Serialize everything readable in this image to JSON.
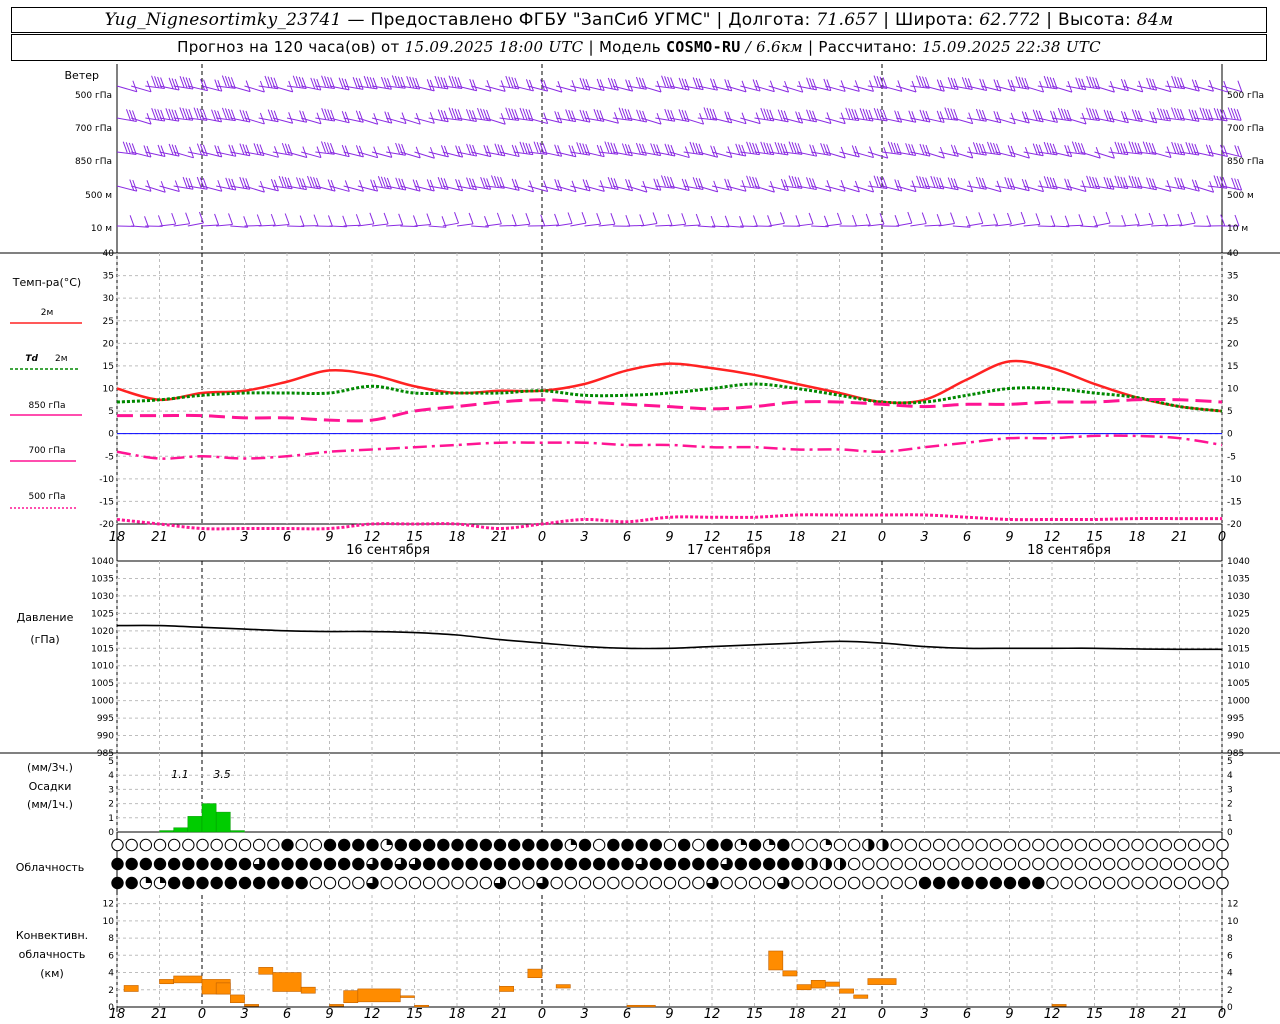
{
  "header": {
    "station": "Yug_Nignesortimky_23741",
    "provider": "— Предоставлено ФГБУ \"ЗапСиб УГМС\"",
    "lon_label": "Долгота:",
    "lon": "71.657",
    "lat_label": "Широта:",
    "lat": "62.772",
    "alt_label": "Высота:",
    "alt": "84м",
    "forecast_label": "Прогноз на 120 часа(ов) от",
    "forecast_start": "15.09.2025 18:00 UTC",
    "model_label": "Модель",
    "model": "COSMO-RU",
    "model_res": "/ 6.6км",
    "calc_label": "Рассчитано:",
    "calc_time": "15.09.2025 22:38 UTC"
  },
  "colors": {
    "t2m": "#ff2222",
    "td": "#008800",
    "t850": "#ff1493",
    "t700": "#ff1493",
    "t500": "#ff1493",
    "wind": "#8a2be2",
    "precip": "#00cc00",
    "conv": "#ff8c00",
    "pressure": "#000000",
    "zero": "#0000ff"
  },
  "wind_panel": {
    "title": "Ветер",
    "levels": [
      "500 гПа",
      "700 гПа",
      "850 гПа",
      "500 м",
      "10 м"
    ]
  },
  "temp_panel": {
    "title": "Темп-ра(°C)",
    "legend": [
      {
        "label": "2м",
        "style": "solid-red"
      },
      {
        "label": "Td",
        "label2": "2м",
        "style": "dotted-green"
      },
      {
        "label": "850 гПа",
        "style": "dashed-magenta"
      },
      {
        "label": "700 гПа",
        "style": "dashdot-magenta"
      },
      {
        "label": "500 гПа",
        "style": "dotted-magenta"
      }
    ]
  },
  "pressure_panel": {
    "title": "Давление",
    "unit": "(гПа)"
  },
  "precip_panel": {
    "unit_top": "(мм/3ч.)",
    "title": "Осадки",
    "unit_bottom": "(мм/1ч.)",
    "annotations": [
      "1.1",
      "3.5"
    ]
  },
  "cloud_panel": {
    "title": "Облачность"
  },
  "conv_panel": {
    "title_line1": "Конвективн.",
    "title_line2": "облачность",
    "unit": "(км)"
  },
  "time_ticks": [
    "18",
    "21",
    "0",
    "3",
    "6",
    "9",
    "12",
    "15",
    "18",
    "21",
    "0",
    "3",
    "6",
    "9",
    "12",
    "15",
    "18",
    "21",
    "0",
    "3",
    "6",
    "9",
    "12",
    "15",
    "18",
    "21",
    "0"
  ],
  "date_labels": [
    "16 сентября",
    "17 сентября",
    "18 сентября"
  ],
  "chart_data": [
    {
      "type": "line",
      "title": "Температура",
      "ylabel": "Темп-ра(°C)",
      "ylim": [
        -20,
        40
      ],
      "yticks": [
        40,
        35,
        30,
        25,
        20,
        15,
        10,
        5,
        0,
        -5,
        -10,
        -15,
        -20
      ],
      "x": [
        0,
        3,
        6,
        9,
        12,
        15,
        18,
        21,
        24,
        27,
        30,
        33,
        36,
        39,
        42,
        45,
        48,
        51,
        54,
        57,
        60,
        63,
        66,
        69,
        72,
        75,
        78
      ],
      "series": [
        {
          "name": "2м",
          "values": [
            10,
            7.5,
            9,
            9.5,
            11.5,
            14,
            13,
            10.5,
            9,
            9.5,
            9.5,
            11,
            14,
            15.5,
            14.5,
            13,
            11,
            9,
            7,
            7.5,
            12,
            16,
            14.5,
            11,
            8,
            6,
            5
          ]
        },
        {
          "name": "Td 2м",
          "values": [
            7,
            7.5,
            8.5,
            9,
            9,
            9,
            10.5,
            9,
            9,
            9,
            9.5,
            8.5,
            8.5,
            9,
            10,
            11,
            10,
            8.5,
            7,
            7,
            8.5,
            10,
            10,
            9,
            8,
            6,
            5
          ]
        },
        {
          "name": "850 гПа",
          "values": [
            4,
            4,
            4,
            3.5,
            3.5,
            3,
            3,
            5,
            6,
            7,
            7.5,
            7,
            6.5,
            6,
            5.5,
            6,
            7,
            7,
            6.5,
            6,
            6.5,
            6.5,
            7,
            7,
            7.5,
            7.5,
            7
          ]
        },
        {
          "name": "700 гПа",
          "values": [
            -4,
            -5.5,
            -5,
            -5.5,
            -5,
            -4,
            -3.5,
            -3,
            -2.5,
            -2,
            -2,
            -2,
            -2.5,
            -2.5,
            -3,
            -3,
            -3.5,
            -3.5,
            -4,
            -3,
            -2,
            -1,
            -1,
            -0.5,
            -0.5,
            -1,
            -2.5
          ]
        },
        {
          "name": "500 гПа",
          "values": [
            -19,
            -20,
            -21,
            -21,
            -21,
            -21,
            -20,
            -20,
            -20,
            -21,
            -20,
            -19,
            -19.5,
            -18.5,
            -18.5,
            -18.5,
            -18,
            -18,
            -18,
            -18,
            -18.5,
            -19,
            -19,
            -19,
            -18.8,
            -18.8,
            -18.8
          ]
        }
      ]
    },
    {
      "type": "line",
      "title": "Давление",
      "ylabel": "(гПа)",
      "ylim": [
        985,
        1040
      ],
      "yticks": [
        1040,
        1035,
        1030,
        1025,
        1020,
        1015,
        1010,
        1005,
        1000,
        995,
        990,
        985
      ],
      "x": [
        0,
        3,
        6,
        9,
        12,
        15,
        18,
        21,
        24,
        27,
        30,
        33,
        36,
        39,
        42,
        45,
        48,
        51,
        54,
        57,
        60,
        63,
        66,
        69,
        72,
        75,
        78
      ],
      "series": [
        {
          "name": "Давление",
          "values": [
            1021.5,
            1021.5,
            1021,
            1020.5,
            1020,
            1019.8,
            1019.8,
            1019.5,
            1018.8,
            1017.5,
            1016.5,
            1015.5,
            1015,
            1015,
            1015.5,
            1016,
            1016.5,
            1017,
            1016.5,
            1015.5,
            1015,
            1015,
            1015,
            1015,
            1014.8,
            1014.7,
            1014.7
          ]
        }
      ]
    },
    {
      "type": "bar",
      "title": "Осадки",
      "ylim": [
        0,
        5
      ],
      "yticks": [
        5,
        4,
        3,
        2,
        1,
        0
      ],
      "x": [
        3,
        4,
        5,
        6,
        7,
        8
      ],
      "values": [
        0.1,
        0.3,
        1.1,
        2.0,
        1.4,
        0.1
      ],
      "totals_3h": [
        1.1,
        3.5
      ]
    },
    {
      "type": "bar",
      "title": "Конвективн. облачность",
      "ylim": [
        0,
        13
      ],
      "yticks": [
        12,
        10,
        8,
        6,
        4,
        2,
        0
      ],
      "segments": [
        {
          "x0": 0.5,
          "x1": 1.5,
          "base": 1.8,
          "top": 2.5
        },
        {
          "x0": 3,
          "x1": 4,
          "base": 2.7,
          "top": 3.2
        },
        {
          "x0": 4,
          "x1": 6,
          "base": 2.8,
          "top": 3.6
        },
        {
          "x0": 6,
          "x1": 8,
          "base": 1.5,
          "top": 3.2
        },
        {
          "x0": 7,
          "x1": 8,
          "base": 1.5,
          "top": 2.8
        },
        {
          "x0": 8,
          "x1": 9,
          "base": 0.5,
          "top": 1.4
        },
        {
          "x0": 9,
          "x1": 10,
          "base": 0.1,
          "top": 0.3
        },
        {
          "x0": 10,
          "x1": 11,
          "base": 3.8,
          "top": 4.6
        },
        {
          "x0": 11,
          "x1": 13,
          "base": 1.8,
          "top": 4.0
        },
        {
          "x0": 13,
          "x1": 14,
          "base": 1.6,
          "top": 2.3
        },
        {
          "x0": 15,
          "x1": 16,
          "base": 0.1,
          "top": 0.3
        },
        {
          "x0": 16,
          "x1": 17,
          "base": 0.5,
          "top": 1.9
        },
        {
          "x0": 17,
          "x1": 20,
          "base": 0.6,
          "top": 2.1
        },
        {
          "x0": 20,
          "x1": 21,
          "base": 1.1,
          "top": 1.3
        },
        {
          "x0": 21,
          "x1": 22,
          "base": 0.1,
          "top": 0.2
        },
        {
          "x0": 27,
          "x1": 28,
          "base": 1.8,
          "top": 2.4
        },
        {
          "x0": 29,
          "x1": 30,
          "base": 3.4,
          "top": 4.4
        },
        {
          "x0": 31,
          "x1": 32,
          "base": 2.2,
          "top": 2.6
        },
        {
          "x0": 36,
          "x1": 38,
          "base": 0.1,
          "top": 0.2
        },
        {
          "x0": 46,
          "x1": 47,
          "base": 4.3,
          "top": 6.5
        },
        {
          "x0": 47,
          "x1": 48,
          "base": 3.6,
          "top": 4.2
        },
        {
          "x0": 48,
          "x1": 49,
          "base": 2.0,
          "top": 2.6
        },
        {
          "x0": 49,
          "x1": 50,
          "base": 2.2,
          "top": 3.1
        },
        {
          "x0": 50,
          "x1": 51,
          "base": 2.4,
          "top": 2.9
        },
        {
          "x0": 51,
          "x1": 52,
          "base": 1.6,
          "top": 2.1
        },
        {
          "x0": 52,
          "x1": 53,
          "base": 1.0,
          "top": 1.4
        },
        {
          "x0": 53,
          "x1": 55,
          "base": 2.6,
          "top": 3.3
        },
        {
          "x0": 66,
          "x1": 67,
          "base": 0.1,
          "top": 0.3
        }
      ]
    }
  ]
}
